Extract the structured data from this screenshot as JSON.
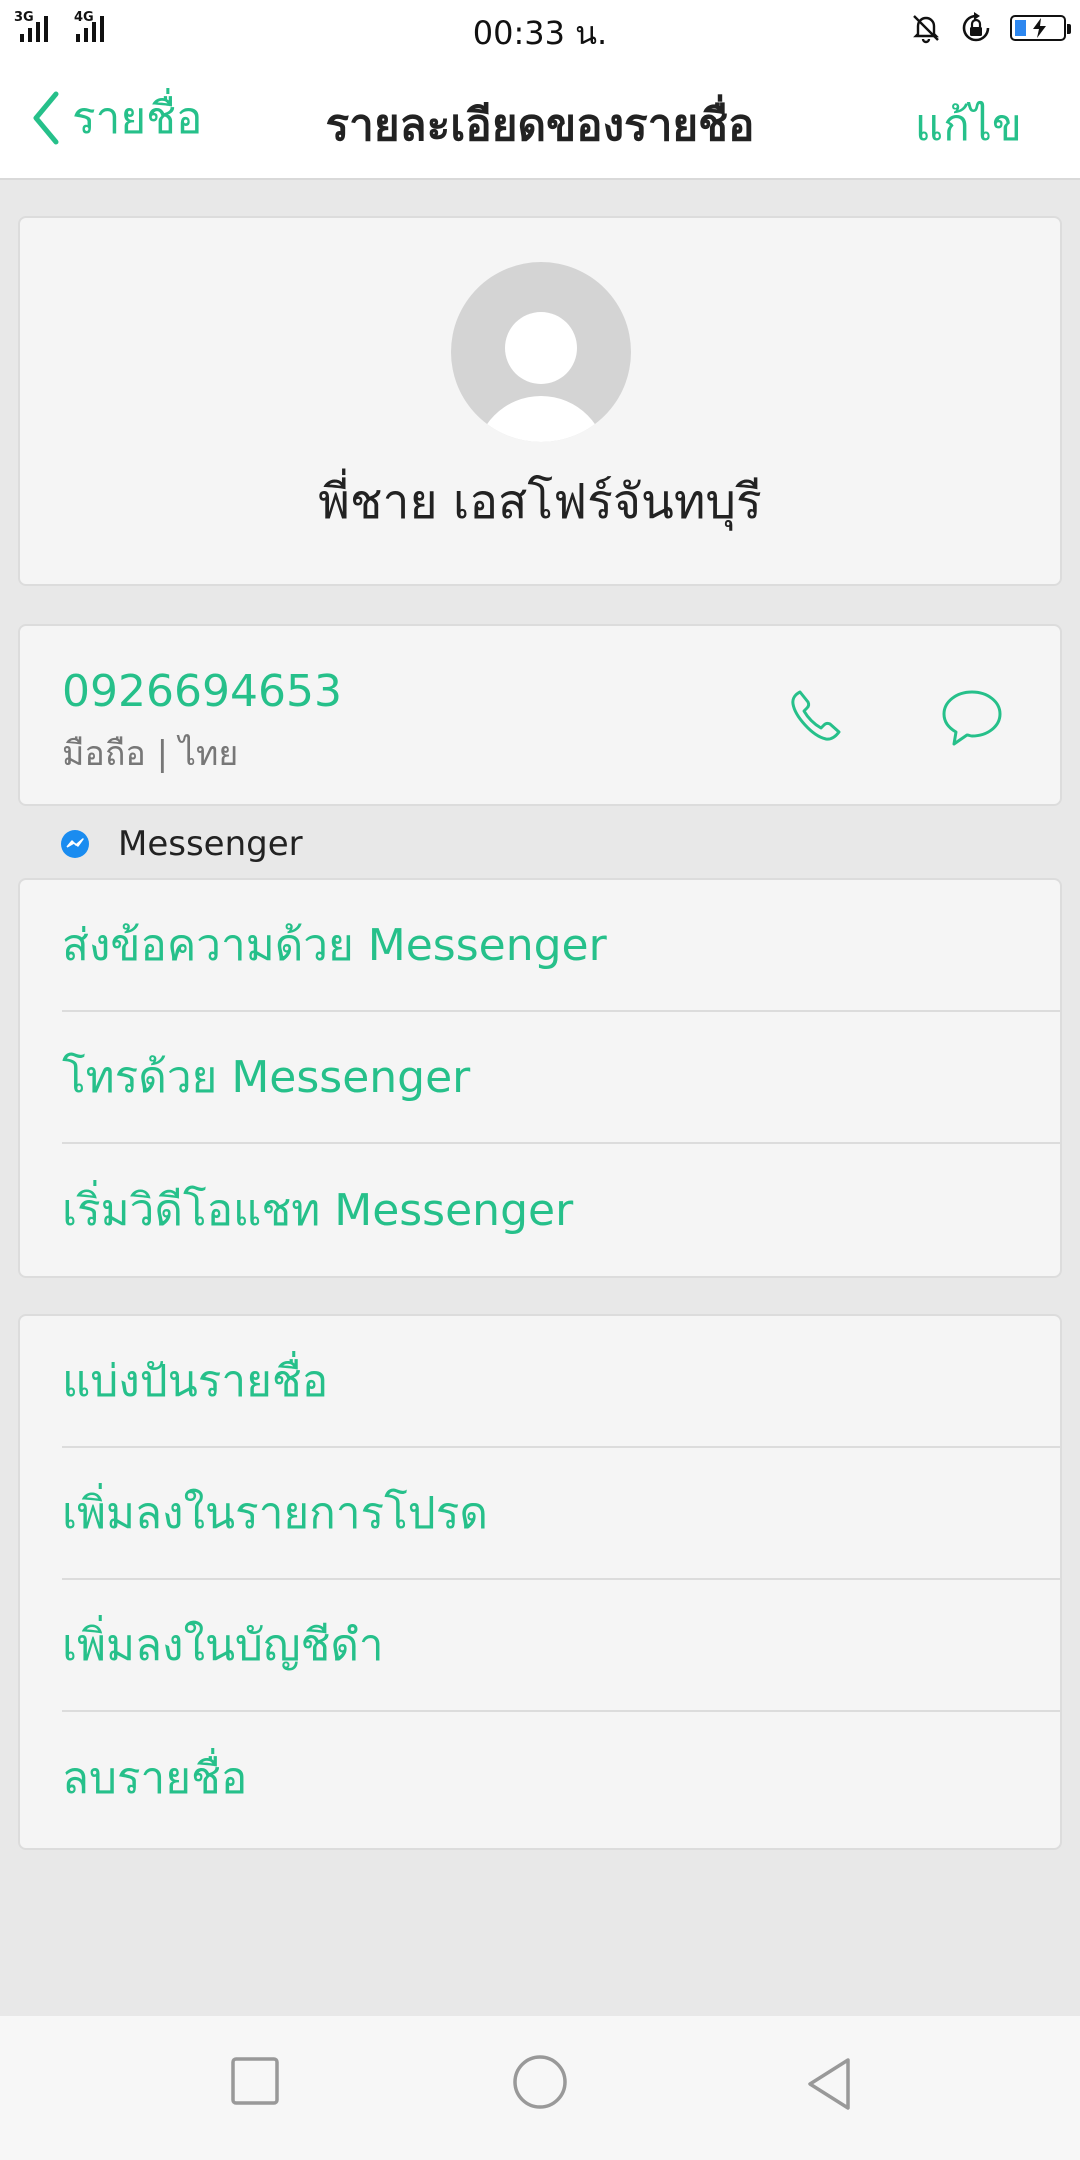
{
  "status_bar": {
    "sim1_tag": "3G",
    "sim2_tag": "4G",
    "time": "00:33 น.",
    "icons": [
      "signal-3g-icon",
      "signal-4g-icon",
      "mute-bell-icon",
      "rotation-lock-icon",
      "battery-charging-icon"
    ],
    "battery_color": "#2d87ef"
  },
  "nav": {
    "back_label": "รายชื่อ",
    "title": "รายละเอียดของรายชื่อ",
    "edit_label": "แก้ไข"
  },
  "contact": {
    "name": "พี่ชาย เอสโฟร์จันทบุรี",
    "phone": "0926694653",
    "phone_label": "มือถือ | ไทย"
  },
  "messenger": {
    "header": "Messenger",
    "actions": [
      {
        "label": "ส่งข้อความด้วย Messenger"
      },
      {
        "label": "โทรด้วย Messenger"
      },
      {
        "label": "เริ่มวิดีโอแชท Messenger"
      }
    ]
  },
  "contact_actions": [
    {
      "label": "แบ่งปันรายชื่อ"
    },
    {
      "label": "เพิ่มลงในรายการโปรด"
    },
    {
      "label": "เพิ่มลงในบัญชีดำ"
    },
    {
      "label": "ลบรายชื่อ"
    }
  ],
  "colors": {
    "accent": "#26c08a",
    "messenger_blue": "#1a8cf0"
  }
}
